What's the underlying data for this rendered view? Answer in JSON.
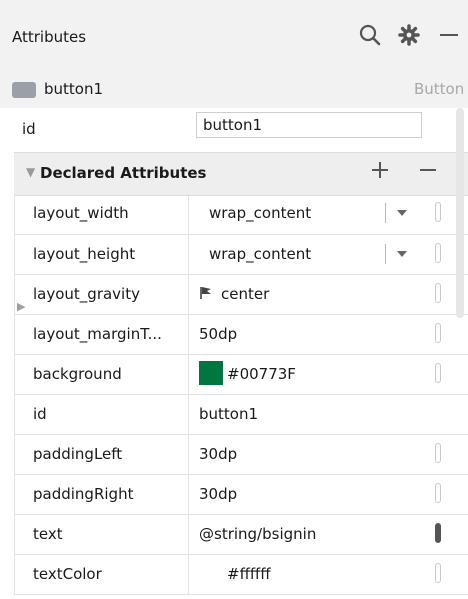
{
  "panel": {
    "title": "Attributes",
    "icons": {
      "search": "search-icon",
      "settings": "gear-icon",
      "minimize": "minimize-icon"
    }
  },
  "component": {
    "name": "button1",
    "type": "Button",
    "icon": "button-widget-icon"
  },
  "id_field": {
    "label": "id",
    "value": "button1"
  },
  "declared": {
    "title": "Declared Attributes",
    "add_icon": "plus-icon",
    "remove_icon": "minus-icon",
    "rows": [
      {
        "name": "layout_width",
        "value": "wrap_content"
      },
      {
        "name": "layout_height",
        "value": "wrap_content"
      },
      {
        "name": "layout_gravity",
        "value": "center"
      },
      {
        "name": "layout_marginT...",
        "value": "50dp"
      },
      {
        "name": "background",
        "value": "#00773F"
      },
      {
        "name": "id",
        "value": "button1"
      },
      {
        "name": "paddingLeft",
        "value": "30dp"
      },
      {
        "name": "paddingRight",
        "value": "30dp"
      },
      {
        "name": "text",
        "value": "@string/bsignin"
      },
      {
        "name": "textColor",
        "value": "#ffffff"
      }
    ]
  },
  "colors": {
    "background_swatch": "#00773F",
    "text_color_swatch": "#ffffff",
    "header_bg": "#f2f2f2"
  }
}
